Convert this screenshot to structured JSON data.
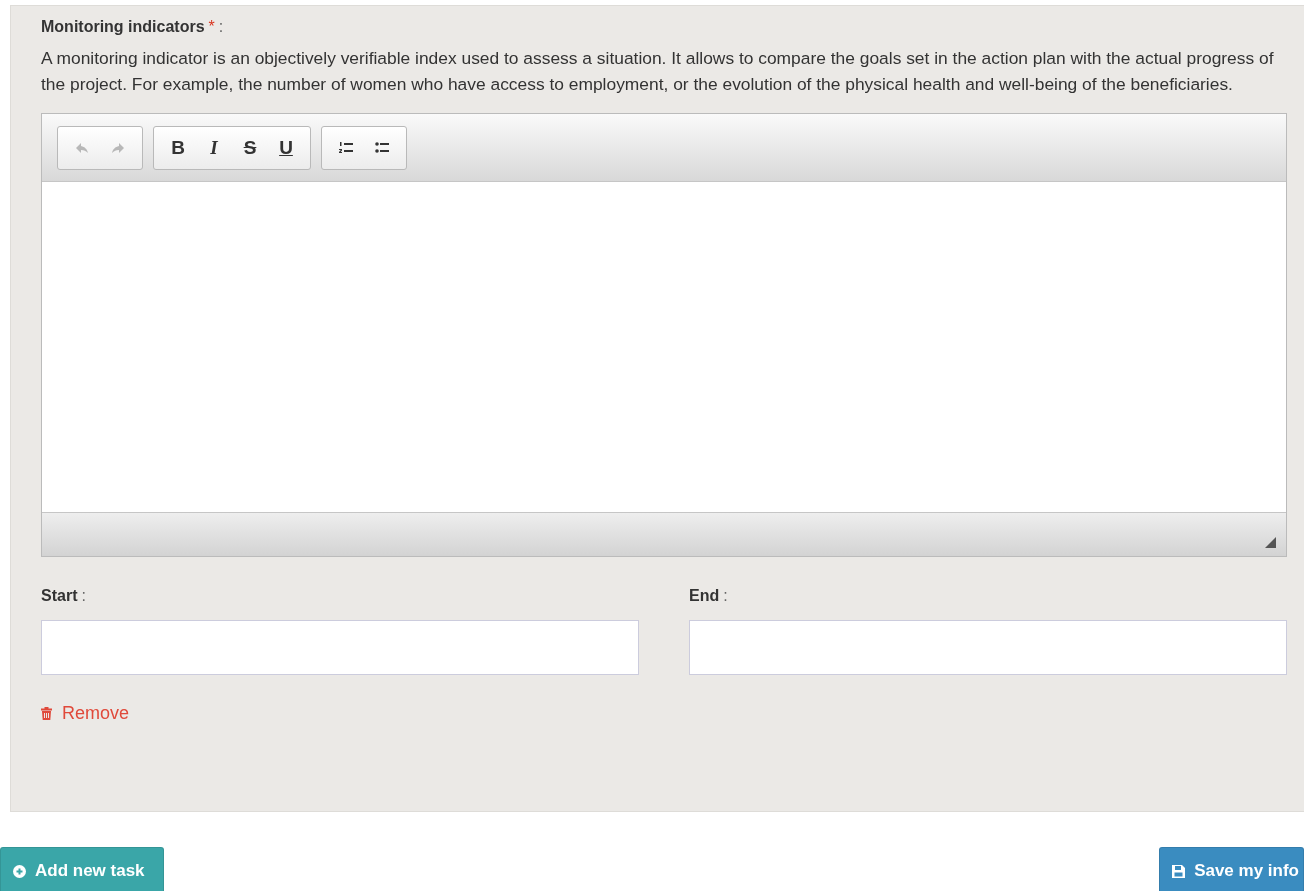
{
  "field": {
    "label": "Monitoring indicators",
    "required_mark": "*",
    "separator": ":",
    "help": "A monitoring indicator is an objectively verifiable index used to assess a situation. It allows to compare the goals set in the action plan with the actual progress of the project. For example, the number of women who have access to employment, or the evolution of the physical health and well-being of the beneficiaries."
  },
  "toolbar": [
    [
      {
        "kind": "undo",
        "disabled": true
      },
      {
        "kind": "redo",
        "disabled": true
      }
    ],
    [
      {
        "kind": "bold",
        "label": "B",
        "disabled": false
      },
      {
        "kind": "italic",
        "label": "I",
        "disabled": false
      },
      {
        "kind": "strike",
        "label": "S",
        "disabled": false
      },
      {
        "kind": "underline",
        "label": "U",
        "disabled": false
      }
    ],
    [
      {
        "kind": "ordered-list",
        "disabled": false
      },
      {
        "kind": "bullet-list",
        "disabled": false
      }
    ]
  ],
  "dates": [
    {
      "label": "Start",
      "separator": ":"
    },
    {
      "label": "End",
      "separator": ":"
    }
  ],
  "remove": {
    "label": "Remove"
  },
  "buttons": [
    {
      "kind": "add",
      "label": "Add new task"
    },
    {
      "kind": "save",
      "label": "Save my info"
    }
  ]
}
